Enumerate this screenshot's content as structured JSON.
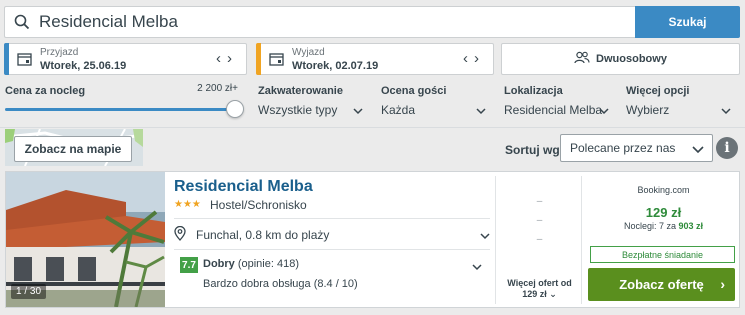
{
  "search": {
    "value": "Residencial Melba",
    "button_label": "Szukaj"
  },
  "dates": {
    "checkin": {
      "label": "Przyjazd",
      "value": "Wtorek, 25.06.19",
      "color": "#3b8ac4"
    },
    "checkout": {
      "label": "Wyjazd",
      "value": "Wtorek, 02.07.19",
      "color": "#f0a422"
    }
  },
  "room": {
    "label": "Dwuosobowy"
  },
  "filters": {
    "price": {
      "title": "Cena za nocleg",
      "max": "2 200 zł+",
      "slider_fraction": 1.0
    },
    "accommodation": {
      "title": "Zakwaterowanie",
      "value": "Wszystkie typy"
    },
    "guest_rating": {
      "title": "Ocena gości",
      "value": "Każda"
    },
    "location": {
      "title": "Lokalizacja",
      "value": "Residencial Melba"
    },
    "more": {
      "title": "Więcej opcji",
      "value": "Wybierz"
    }
  },
  "map": {
    "button_label": "Zobacz na mapie"
  },
  "sort": {
    "label": "Sortuj wg",
    "value": "Polecane przez nas"
  },
  "hotel": {
    "name": "Residencial Melba",
    "stars": 3,
    "stars_glyph": "★★★",
    "type": "Hostel/Schronisko",
    "location": "Funchal, 0.8 km do plaży",
    "score": "7.7",
    "rating_word": "Dobry",
    "rating_count": "(opinie: 418)",
    "rating_detail": "Bardzo dobra obsługa (8.4 / 10)",
    "photo_counter": "1 / 30",
    "deals_placeholders": [
      "–",
      "–",
      "–"
    ],
    "more_offers_line1": "Więcej ofert od",
    "more_offers_line2": "129 zł",
    "offer": {
      "provider": "Booking.com",
      "price": "129 zł",
      "nights_prefix": "Noclegi: 7 za",
      "nights_total": "903 zł",
      "badge": "Bezpłatne śniadanie",
      "cta_label": "Zobacz ofertę"
    }
  },
  "colors": {
    "accent": "#3b8ac4",
    "cta": "#5a8f1e",
    "score": "#43a047",
    "title": "#1a5f8c"
  }
}
